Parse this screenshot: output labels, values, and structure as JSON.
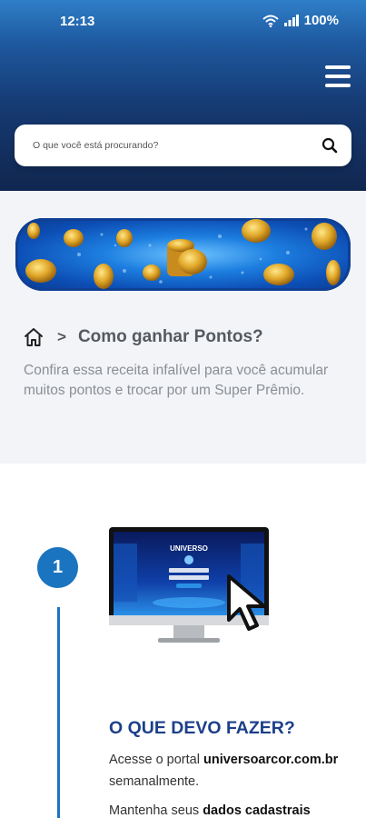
{
  "status_bar": {
    "time": "12:13",
    "battery": "100%"
  },
  "header": {
    "search": {
      "placeholder": "O que você está procurando?"
    }
  },
  "breadcrumb": {
    "separator": ">",
    "title": "Como ganhar Pontos?"
  },
  "intro": "Confira essa receita infalível para você acumular muitos pontos e trocar por um Super Prêmio.",
  "banner": {
    "illustration": "gold-coins-banner"
  },
  "step": {
    "number": "1",
    "illustration_text": "UNIVERSO",
    "section_title": "O QUE DEVO FAZER?",
    "p1": {
      "before": "Acesse o portal ",
      "bold": "universoarcor.com.br",
      "after": " semanalmente."
    },
    "p2": {
      "before": "Mantenha seus ",
      "bold": "dados cadastrais"
    }
  },
  "colors": {
    "header_top": "#2f7fc8",
    "header_bottom": "#10264f",
    "accent": "#1b74bf",
    "title": "#1c3f8a"
  }
}
